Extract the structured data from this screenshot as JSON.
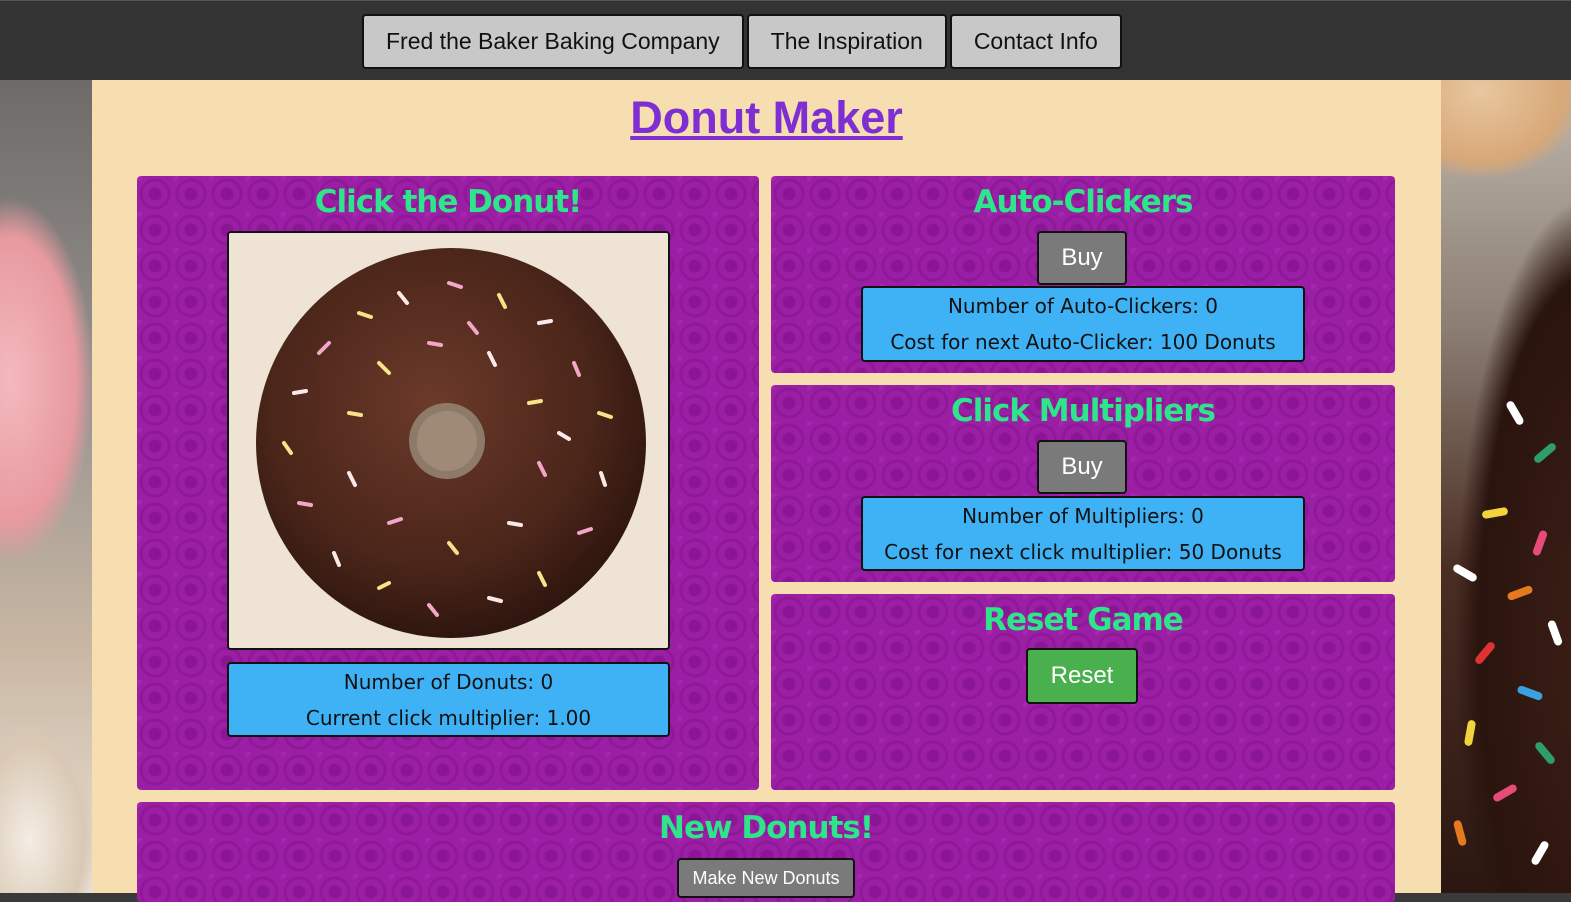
{
  "nav": {
    "items": [
      "Fred the Baker Baking Company",
      "The Inspiration",
      "Contact Info"
    ]
  },
  "page": {
    "title": "Donut Maker"
  },
  "click_panel": {
    "heading": "Click the Donut!",
    "donut_count": "Number of Donuts: 0",
    "click_multiplier": "Current click multiplier: 1.00"
  },
  "auto_clickers": {
    "heading": "Auto-Clickers",
    "buy_label": "Buy",
    "count": "Number of Auto-Clickers: 0",
    "cost": "Cost for next Auto-Clicker: 100 Donuts"
  },
  "multipliers": {
    "heading": "Click Multipliers",
    "buy_label": "Buy",
    "count": "Number of Multipliers: 0",
    "cost": "Cost for next click multiplier: 50 Donuts"
  },
  "reset": {
    "heading": "Reset Game",
    "button_label": "Reset"
  },
  "new_donuts": {
    "heading": "New Donuts!",
    "button_label": "Make New Donuts"
  },
  "colors": {
    "panel": "#9b1fa4",
    "heading": "#2ee68a",
    "info_box": "#3fb2f6",
    "title": "#7f2ed3",
    "page_bg": "#f6deb1",
    "reset_button": "#49b04d"
  }
}
